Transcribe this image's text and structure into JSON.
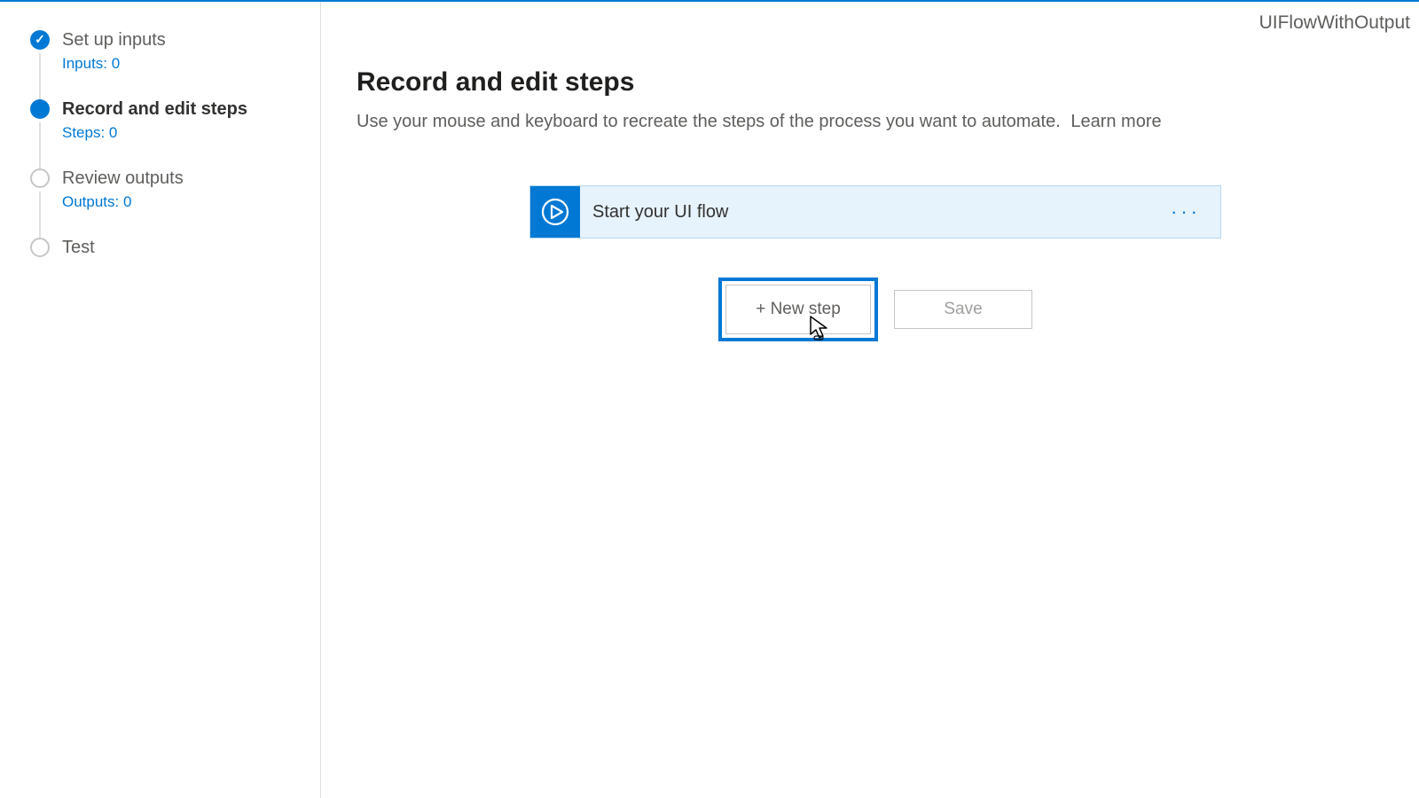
{
  "flowName": "UIFlowWithOutput",
  "sidebar": {
    "items": [
      {
        "title": "Set up inputs",
        "sub": "Inputs: 0"
      },
      {
        "title": "Record and edit steps",
        "sub": "Steps: 0"
      },
      {
        "title": "Review outputs",
        "sub": "Outputs: 0"
      },
      {
        "title": "Test"
      }
    ]
  },
  "page": {
    "heading": "Record and edit steps",
    "description": "Use your mouse and keyboard to recreate the steps of the process you want to automate.",
    "learnMore": "Learn more"
  },
  "card": {
    "label": "Start your UI flow",
    "moreGlyph": "···"
  },
  "buttons": {
    "newStep": "+ New step",
    "save": "Save"
  }
}
